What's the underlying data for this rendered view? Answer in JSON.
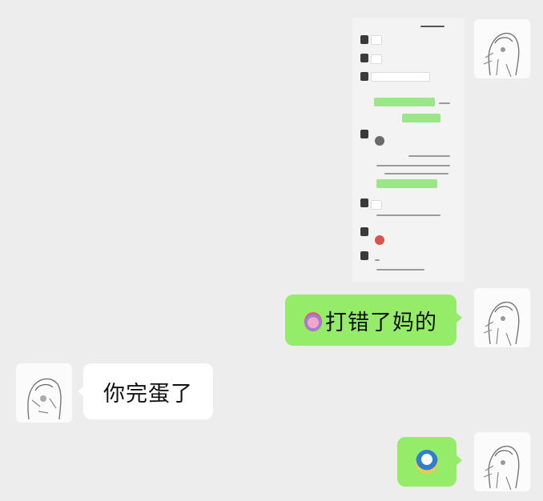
{
  "messages": [
    {
      "id": "m1",
      "side": "right",
      "type": "text",
      "text": "打错了妈的",
      "emoji": "clown-face-icon"
    },
    {
      "id": "m2",
      "side": "left",
      "type": "text",
      "text": "你完蛋了"
    },
    {
      "id": "m3",
      "side": "right",
      "type": "sticker",
      "icon": "emoji-sticker-icon"
    }
  ],
  "colors": {
    "background": "#ededed",
    "bubble_green": "#95ec69",
    "bubble_white": "#ffffff"
  }
}
